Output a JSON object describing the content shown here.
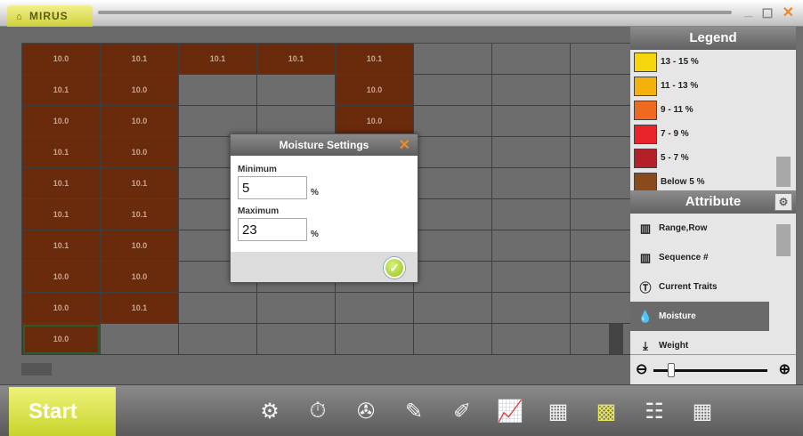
{
  "window": {
    "app_name": "MIRUS",
    "controls": {
      "minimize": "_",
      "maximize": "◻",
      "close": "✕"
    }
  },
  "grid": {
    "rows": [
      [
        {
          "v": "10.0",
          "c": "brown"
        },
        {
          "v": "10.1",
          "c": "brown"
        },
        {
          "v": "10.1",
          "c": "brown"
        },
        {
          "v": "10.1",
          "c": "brown"
        },
        {
          "v": "10.1",
          "c": "brown"
        },
        {
          "v": "",
          "c": "gray"
        },
        {
          "v": "",
          "c": "gray"
        },
        {
          "v": "",
          "c": "gray"
        }
      ],
      [
        {
          "v": "10.1",
          "c": "brown"
        },
        {
          "v": "10.0",
          "c": "brown"
        },
        {
          "v": "",
          "c": "gray"
        },
        {
          "v": "",
          "c": "gray"
        },
        {
          "v": "10.0",
          "c": "brown"
        },
        {
          "v": "",
          "c": "gray"
        },
        {
          "v": "",
          "c": "gray"
        },
        {
          "v": "",
          "c": "gray"
        }
      ],
      [
        {
          "v": "10.0",
          "c": "brown"
        },
        {
          "v": "10.0",
          "c": "brown"
        },
        {
          "v": "",
          "c": "gray"
        },
        {
          "v": "",
          "c": "gray"
        },
        {
          "v": "10.0",
          "c": "brown"
        },
        {
          "v": "",
          "c": "gray"
        },
        {
          "v": "",
          "c": "gray"
        },
        {
          "v": "",
          "c": "gray"
        }
      ],
      [
        {
          "v": "10.1",
          "c": "brown"
        },
        {
          "v": "10.0",
          "c": "brown"
        },
        {
          "v": "",
          "c": "gray"
        },
        {
          "v": "",
          "c": "gray"
        },
        {
          "v": "",
          "c": "brown"
        },
        {
          "v": "",
          "c": "gray"
        },
        {
          "v": "",
          "c": "gray"
        },
        {
          "v": "",
          "c": "gray"
        }
      ],
      [
        {
          "v": "10.1",
          "c": "brown"
        },
        {
          "v": "10.1",
          "c": "brown"
        },
        {
          "v": "",
          "c": "gray"
        },
        {
          "v": "",
          "c": "gray"
        },
        {
          "v": "",
          "c": "gray"
        },
        {
          "v": "",
          "c": "gray"
        },
        {
          "v": "",
          "c": "gray"
        },
        {
          "v": "",
          "c": "gray"
        }
      ],
      [
        {
          "v": "10.1",
          "c": "brown"
        },
        {
          "v": "10.1",
          "c": "brown"
        },
        {
          "v": "",
          "c": "gray"
        },
        {
          "v": "",
          "c": "gray"
        },
        {
          "v": "",
          "c": "gray"
        },
        {
          "v": "",
          "c": "gray"
        },
        {
          "v": "",
          "c": "gray"
        },
        {
          "v": "",
          "c": "gray"
        }
      ],
      [
        {
          "v": "10.1",
          "c": "brown"
        },
        {
          "v": "10.0",
          "c": "brown"
        },
        {
          "v": "",
          "c": "gray"
        },
        {
          "v": "",
          "c": "gray"
        },
        {
          "v": "",
          "c": "gray"
        },
        {
          "v": "",
          "c": "gray"
        },
        {
          "v": "",
          "c": "gray"
        },
        {
          "v": "",
          "c": "gray"
        }
      ],
      [
        {
          "v": "10.0",
          "c": "brown"
        },
        {
          "v": "10.0",
          "c": "brown"
        },
        {
          "v": "",
          "c": "gray"
        },
        {
          "v": "",
          "c": "gray"
        },
        {
          "v": "",
          "c": "gray"
        },
        {
          "v": "",
          "c": "gray"
        },
        {
          "v": "",
          "c": "gray"
        },
        {
          "v": "",
          "c": "gray"
        }
      ],
      [
        {
          "v": "10.0",
          "c": "brown"
        },
        {
          "v": "10.1",
          "c": "brown"
        },
        {
          "v": "",
          "c": "gray"
        },
        {
          "v": "",
          "c": "gray"
        },
        {
          "v": "",
          "c": "gray"
        },
        {
          "v": "",
          "c": "gray"
        },
        {
          "v": "",
          "c": "gray"
        },
        {
          "v": "",
          "c": "gray"
        }
      ],
      [
        {
          "v": "10.0",
          "c": "brown",
          "sel": true
        },
        {
          "v": "",
          "c": "gray"
        },
        {
          "v": "",
          "c": "gray"
        },
        {
          "v": "",
          "c": "gray"
        },
        {
          "v": "",
          "c": "gray"
        },
        {
          "v": "",
          "c": "gray"
        },
        {
          "v": "",
          "c": "gray"
        },
        {
          "v": "",
          "c": "gray"
        }
      ]
    ]
  },
  "dialog": {
    "title": "Moisture Settings",
    "min_label": "Minimum",
    "min_value": "5",
    "max_label": "Maximum",
    "max_value": "23",
    "unit": "%"
  },
  "legend": {
    "title": "Legend",
    "items": [
      {
        "label": "13 - 15 %",
        "color": "#f5d60c"
      },
      {
        "label": "11 - 13 %",
        "color": "#f4b10e"
      },
      {
        "label": "9 - 11 %",
        "color": "#ef6a21"
      },
      {
        "label": "7 - 9 %",
        "color": "#e8242a"
      },
      {
        "label": "5 - 7 %",
        "color": "#b3202a"
      },
      {
        "label": "Below 5 %",
        "color": "#8a4a1e"
      }
    ]
  },
  "attribute": {
    "title": "Attribute",
    "items": [
      {
        "label": "Range,Row",
        "icon": "barcode-icon",
        "glyph": "▥"
      },
      {
        "label": "Sequence #",
        "icon": "barcode-icon",
        "glyph": "▥"
      },
      {
        "label": "Current Traits",
        "icon": "traits-icon",
        "glyph": "Ⓣ"
      },
      {
        "label": "Moisture",
        "icon": "droplet-icon",
        "glyph": "💧",
        "active": true
      },
      {
        "label": "Weight",
        "icon": "weight-icon",
        "glyph": "⤓"
      }
    ]
  },
  "toolbar": {
    "start_label": "Start",
    "tools": [
      {
        "name": "settings-gear-icon",
        "glyph": "⚙"
      },
      {
        "name": "timer-icon",
        "glyph": "⏱"
      },
      {
        "name": "compass-icon",
        "glyph": "✇"
      },
      {
        "name": "pencil-icon",
        "glyph": "✎"
      },
      {
        "name": "edit-icon",
        "glyph": "✐"
      },
      {
        "name": "chart-icon",
        "glyph": "📈"
      },
      {
        "name": "grid-view-icon",
        "glyph": "▦"
      },
      {
        "name": "field-map-icon",
        "glyph": "▩",
        "active": true
      },
      {
        "name": "table-icon",
        "glyph": "☷"
      },
      {
        "name": "keypad-icon",
        "glyph": "▦"
      }
    ]
  }
}
